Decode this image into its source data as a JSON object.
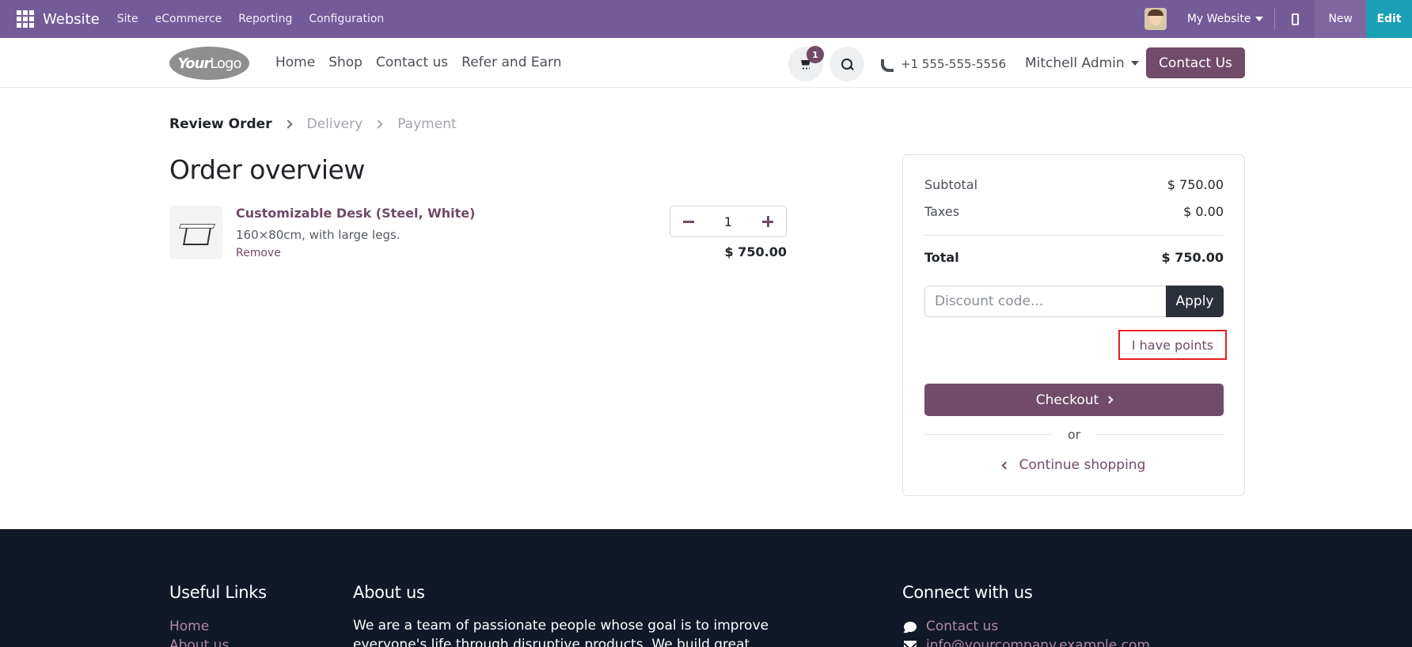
{
  "adminbar": {
    "brand": "Website",
    "menus": [
      "Site",
      "eCommerce",
      "Reporting",
      "Configuration"
    ],
    "website_selector": "My Website",
    "new_label": "New",
    "edit_label": "Edit",
    "accent_color": "#735b98"
  },
  "header": {
    "logo_bold": "Your",
    "logo_rest": "Logo",
    "nav": [
      "Home",
      "Shop",
      "Contact us",
      "Refer and Earn"
    ],
    "cart_count": "1",
    "phone": "+1 555-555-5556",
    "user": "Mitchell Admin",
    "contact_button": "Contact Us",
    "brand_color": "#714b67"
  },
  "steps": {
    "active": "Review Order",
    "delivery": "Delivery",
    "payment": "Payment"
  },
  "page_title": "Order overview",
  "cart_line": {
    "name": "Customizable Desk (Steel, White)",
    "description": "160×80cm, with large legs.",
    "remove_label": "Remove",
    "quantity": "1",
    "price": "$ 750.00"
  },
  "summary": {
    "subtotal_label": "Subtotal",
    "subtotal_value": "$ 750.00",
    "taxes_label": "Taxes",
    "taxes_value": "$ 0.00",
    "total_label": "Total",
    "total_value": "$ 750.00",
    "discount_placeholder": "Discount code...",
    "apply_label": "Apply",
    "points_label": "I have points",
    "checkout_label": "Checkout",
    "or_label": "or",
    "continue_label": "Continue shopping"
  },
  "footer": {
    "useful_links_title": "Useful Links",
    "useful_links": [
      "Home",
      "About us"
    ],
    "about_title": "About us",
    "about_text": "We are a team of passionate people whose goal is to improve everyone's life through disruptive products. We build great products",
    "connect_title": "Connect with us",
    "contact_link": "Contact us",
    "email": "info@yourcompany.example.com"
  }
}
